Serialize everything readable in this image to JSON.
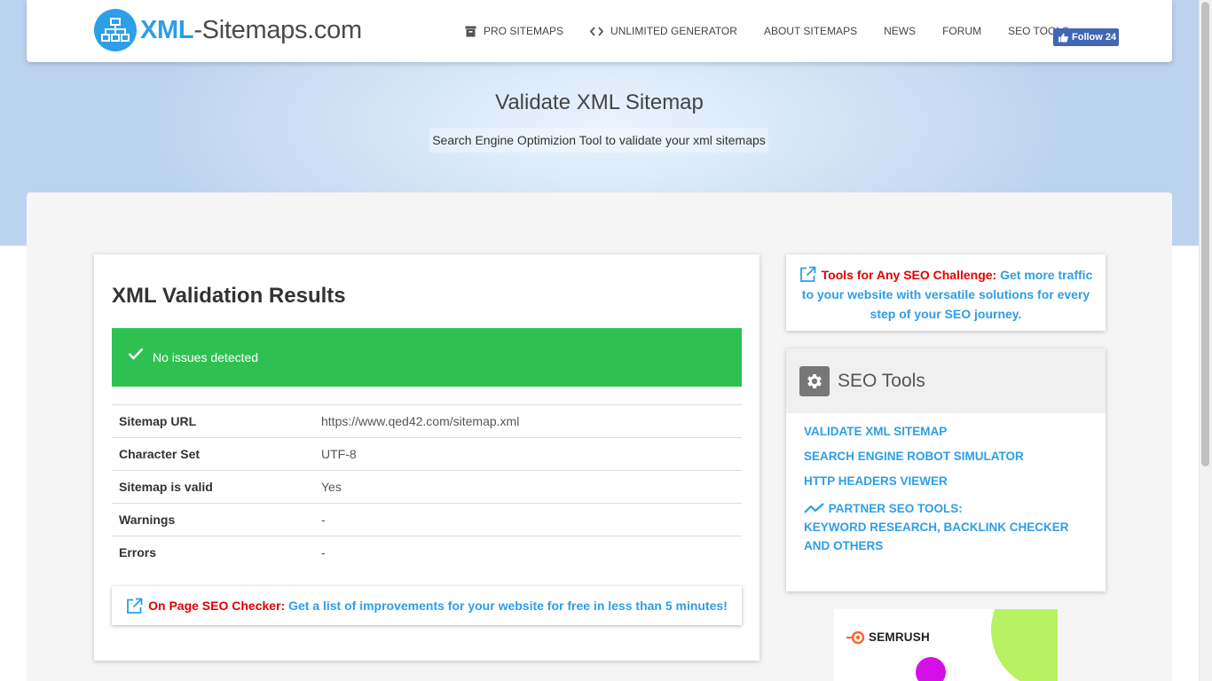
{
  "brand": {
    "name_accent": "XML",
    "name_rest": "-Sitemaps.com"
  },
  "nav": {
    "items": [
      {
        "label": "PRO SITEMAPS",
        "icon": "archive-icon"
      },
      {
        "label": "UNLIMITED GENERATOR",
        "icon": "code-icon"
      },
      {
        "label": "ABOUT SITEMAPS"
      },
      {
        "label": "NEWS"
      },
      {
        "label": "FORUM"
      },
      {
        "label": "SEO TOOLS"
      }
    ],
    "fb_follow": "Follow 24"
  },
  "hero": {
    "title": "Validate XML Sitemap",
    "subtitle": "Search Engine Optimizion Tool to validate your xml sitemaps"
  },
  "results": {
    "title": "XML Validation Results",
    "status": "No issues detected",
    "rows": [
      {
        "key": "Sitemap URL",
        "value": "https://www.qed42.com/sitemap.xml"
      },
      {
        "key": "Character Set",
        "value": "UTF-8"
      },
      {
        "key": "Sitemap is valid",
        "value": "Yes"
      },
      {
        "key": "Warnings",
        "value": "-"
      },
      {
        "key": "Errors",
        "value": "-"
      }
    ],
    "onpage_label": "On Page SEO Checker:",
    "onpage_link": "Get a list of improvements for your website for free in less than 5 minutes!"
  },
  "promo": {
    "label": "Tools for Any SEO Challenge:",
    "text": "Get more traffic to your website with versatile solutions for every step of your SEO journey."
  },
  "seo_tools": {
    "title": "SEO Tools",
    "links": [
      "VALIDATE XML SITEMAP",
      "SEARCH ENGINE ROBOT SIMULATOR",
      "HTTP HEADERS VIEWER"
    ],
    "partner_label": "PARTNER SEO TOOLS:",
    "partner_text": "KEYWORD RESEARCH, BACKLINK CHECKER AND OTHERS"
  },
  "ad": {
    "brand": "SEMRUSH"
  },
  "colors": {
    "accent": "#2d9ee8",
    "success": "#2ec152",
    "highlight_red": "#e00000",
    "fb": "#4267b2"
  }
}
